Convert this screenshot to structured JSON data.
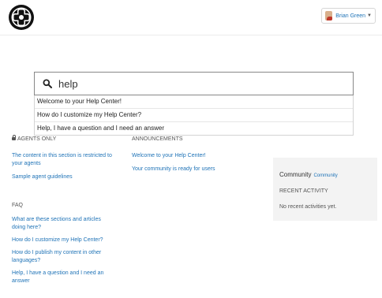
{
  "header": {
    "user": {
      "name": "Brian Green",
      "menu_icon": "chevron-down-icon",
      "avatar_icon": "avatar"
    },
    "logo_icon": "help-center-logo-icon"
  },
  "search": {
    "value": "help",
    "icon": "search-icon",
    "suggestions": [
      "Welcome to your Help Center!",
      "How do I customize my Help Center?",
      "Help, I have a question and I need an answer"
    ]
  },
  "agents_only": {
    "heading": "AGENTS ONLY",
    "links": [
      "The content in this section is restricted to your agents",
      "Sample agent guidelines"
    ]
  },
  "announcements": {
    "heading": "ANNOUNCEMENTS",
    "links": [
      "Welcome to your Help Center!",
      "Your community is ready for users"
    ]
  },
  "faq": {
    "heading": "FAQ",
    "links": [
      "What are these sections and articles doing here?",
      "How do I customize my Help Center?",
      "How do I publish my content in other languages?",
      "Help, I have a question and I need an answer"
    ]
  },
  "community": {
    "title": "Community",
    "link": "Community",
    "recent_heading": "RECENT ACTIVITY",
    "empty_text": "No recent activities yet."
  },
  "colors": {
    "link": "#1f73b7",
    "sidebar_bg": "#f3f3f3"
  }
}
